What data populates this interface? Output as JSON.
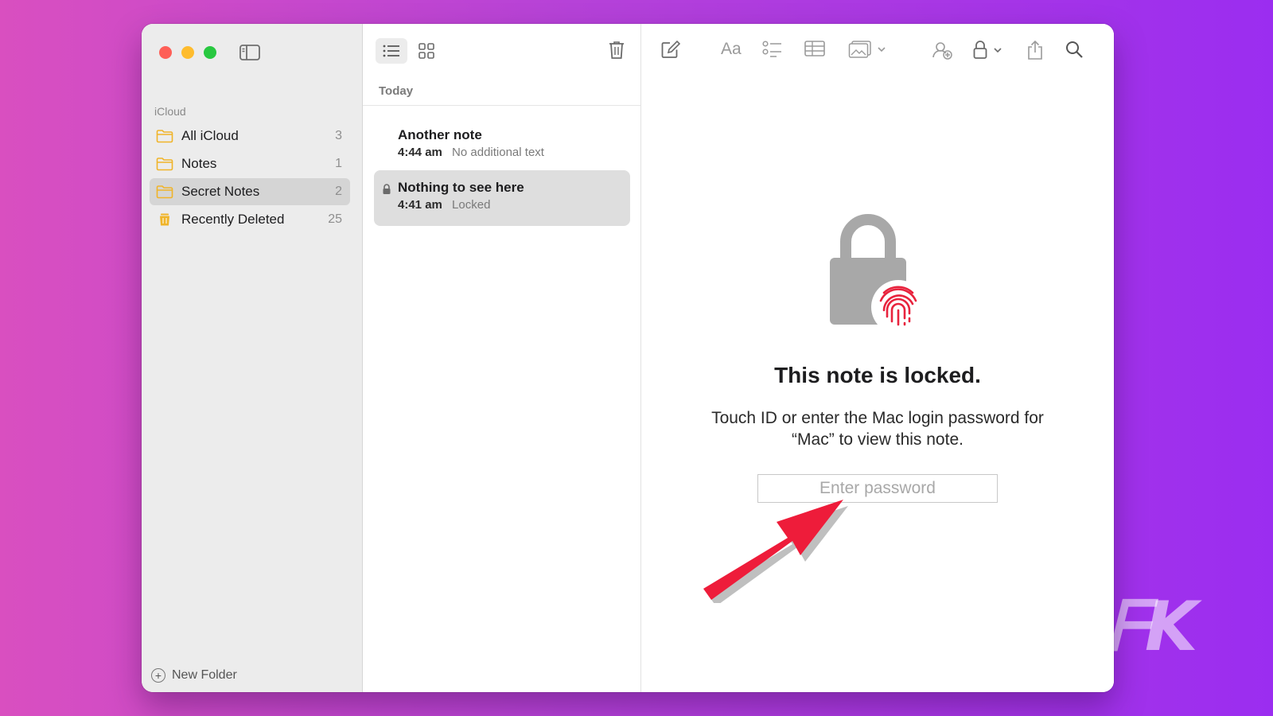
{
  "sidebar": {
    "section_label": "iCloud",
    "folders": [
      {
        "name": "All iCloud",
        "count": "3",
        "icon": "folder-icon"
      },
      {
        "name": "Notes",
        "count": "1",
        "icon": "folder-icon"
      },
      {
        "name": "Secret Notes",
        "count": "2",
        "icon": "folder-icon",
        "selected": true
      },
      {
        "name": "Recently Deleted",
        "count": "25",
        "icon": "trash-icon"
      }
    ],
    "new_folder_label": "New Folder"
  },
  "note_list": {
    "group_label": "Today",
    "notes": [
      {
        "title": "Another note",
        "time": "4:44 am",
        "snippet": "No additional text",
        "locked": false
      },
      {
        "title": "Nothing to see here",
        "time": "4:41 am",
        "snippet": "Locked",
        "locked": true,
        "selected": true
      }
    ]
  },
  "editor": {
    "toolbar": {
      "format_label": "Aa"
    },
    "locked": {
      "title": "This note is locked.",
      "description_line1": "Touch ID or enter the Mac login password for",
      "description_line2": "“Mac” to view this note.",
      "password_placeholder": "Enter password"
    }
  },
  "watermark": "FK",
  "colors": {
    "accent_folder": "#f0b429",
    "close": "#fe5f57",
    "minimize": "#febc2e",
    "maximize": "#28c840",
    "fingerprint": "#e8233d",
    "arrow": "#ee1c3a"
  }
}
